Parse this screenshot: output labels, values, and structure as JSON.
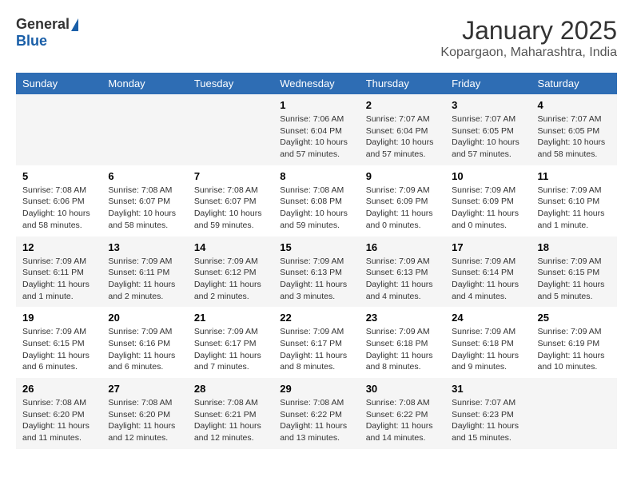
{
  "logo": {
    "general": "General",
    "blue": "Blue"
  },
  "title": "January 2025",
  "subtitle": "Kopargaon, Maharashtra, India",
  "days_of_week": [
    "Sunday",
    "Monday",
    "Tuesday",
    "Wednesday",
    "Thursday",
    "Friday",
    "Saturday"
  ],
  "weeks": [
    [
      {
        "day": "",
        "info": ""
      },
      {
        "day": "",
        "info": ""
      },
      {
        "day": "",
        "info": ""
      },
      {
        "day": "1",
        "info": "Sunrise: 7:06 AM\nSunset: 6:04 PM\nDaylight: 10 hours\nand 57 minutes."
      },
      {
        "day": "2",
        "info": "Sunrise: 7:07 AM\nSunset: 6:04 PM\nDaylight: 10 hours\nand 57 minutes."
      },
      {
        "day": "3",
        "info": "Sunrise: 7:07 AM\nSunset: 6:05 PM\nDaylight: 10 hours\nand 57 minutes."
      },
      {
        "day": "4",
        "info": "Sunrise: 7:07 AM\nSunset: 6:05 PM\nDaylight: 10 hours\nand 58 minutes."
      }
    ],
    [
      {
        "day": "5",
        "info": "Sunrise: 7:08 AM\nSunset: 6:06 PM\nDaylight: 10 hours\nand 58 minutes."
      },
      {
        "day": "6",
        "info": "Sunrise: 7:08 AM\nSunset: 6:07 PM\nDaylight: 10 hours\nand 58 minutes."
      },
      {
        "day": "7",
        "info": "Sunrise: 7:08 AM\nSunset: 6:07 PM\nDaylight: 10 hours\nand 59 minutes."
      },
      {
        "day": "8",
        "info": "Sunrise: 7:08 AM\nSunset: 6:08 PM\nDaylight: 10 hours\nand 59 minutes."
      },
      {
        "day": "9",
        "info": "Sunrise: 7:09 AM\nSunset: 6:09 PM\nDaylight: 11 hours\nand 0 minutes."
      },
      {
        "day": "10",
        "info": "Sunrise: 7:09 AM\nSunset: 6:09 PM\nDaylight: 11 hours\nand 0 minutes."
      },
      {
        "day": "11",
        "info": "Sunrise: 7:09 AM\nSunset: 6:10 PM\nDaylight: 11 hours\nand 1 minute."
      }
    ],
    [
      {
        "day": "12",
        "info": "Sunrise: 7:09 AM\nSunset: 6:11 PM\nDaylight: 11 hours\nand 1 minute."
      },
      {
        "day": "13",
        "info": "Sunrise: 7:09 AM\nSunset: 6:11 PM\nDaylight: 11 hours\nand 2 minutes."
      },
      {
        "day": "14",
        "info": "Sunrise: 7:09 AM\nSunset: 6:12 PM\nDaylight: 11 hours\nand 2 minutes."
      },
      {
        "day": "15",
        "info": "Sunrise: 7:09 AM\nSunset: 6:13 PM\nDaylight: 11 hours\nand 3 minutes."
      },
      {
        "day": "16",
        "info": "Sunrise: 7:09 AM\nSunset: 6:13 PM\nDaylight: 11 hours\nand 4 minutes."
      },
      {
        "day": "17",
        "info": "Sunrise: 7:09 AM\nSunset: 6:14 PM\nDaylight: 11 hours\nand 4 minutes."
      },
      {
        "day": "18",
        "info": "Sunrise: 7:09 AM\nSunset: 6:15 PM\nDaylight: 11 hours\nand 5 minutes."
      }
    ],
    [
      {
        "day": "19",
        "info": "Sunrise: 7:09 AM\nSunset: 6:15 PM\nDaylight: 11 hours\nand 6 minutes."
      },
      {
        "day": "20",
        "info": "Sunrise: 7:09 AM\nSunset: 6:16 PM\nDaylight: 11 hours\nand 6 minutes."
      },
      {
        "day": "21",
        "info": "Sunrise: 7:09 AM\nSunset: 6:17 PM\nDaylight: 11 hours\nand 7 minutes."
      },
      {
        "day": "22",
        "info": "Sunrise: 7:09 AM\nSunset: 6:17 PM\nDaylight: 11 hours\nand 8 minutes."
      },
      {
        "day": "23",
        "info": "Sunrise: 7:09 AM\nSunset: 6:18 PM\nDaylight: 11 hours\nand 8 minutes."
      },
      {
        "day": "24",
        "info": "Sunrise: 7:09 AM\nSunset: 6:18 PM\nDaylight: 11 hours\nand 9 minutes."
      },
      {
        "day": "25",
        "info": "Sunrise: 7:09 AM\nSunset: 6:19 PM\nDaylight: 11 hours\nand 10 minutes."
      }
    ],
    [
      {
        "day": "26",
        "info": "Sunrise: 7:08 AM\nSunset: 6:20 PM\nDaylight: 11 hours\nand 11 minutes."
      },
      {
        "day": "27",
        "info": "Sunrise: 7:08 AM\nSunset: 6:20 PM\nDaylight: 11 hours\nand 12 minutes."
      },
      {
        "day": "28",
        "info": "Sunrise: 7:08 AM\nSunset: 6:21 PM\nDaylight: 11 hours\nand 12 minutes."
      },
      {
        "day": "29",
        "info": "Sunrise: 7:08 AM\nSunset: 6:22 PM\nDaylight: 11 hours\nand 13 minutes."
      },
      {
        "day": "30",
        "info": "Sunrise: 7:08 AM\nSunset: 6:22 PM\nDaylight: 11 hours\nand 14 minutes."
      },
      {
        "day": "31",
        "info": "Sunrise: 7:07 AM\nSunset: 6:23 PM\nDaylight: 11 hours\nand 15 minutes."
      },
      {
        "day": "",
        "info": ""
      }
    ]
  ]
}
